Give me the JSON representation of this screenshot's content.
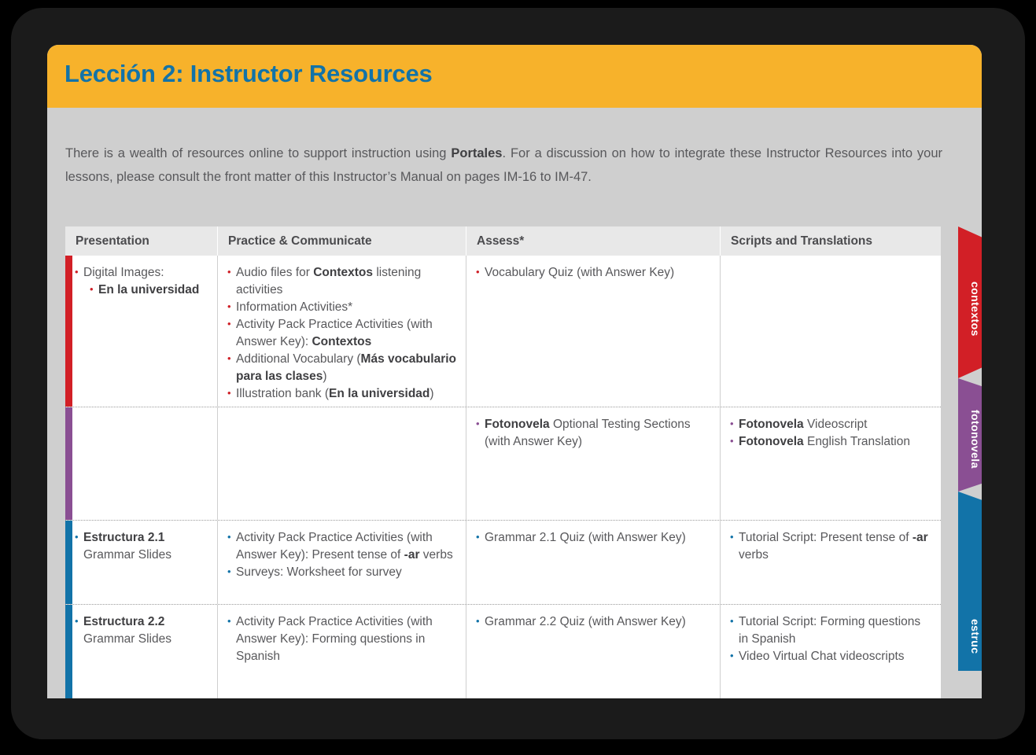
{
  "header": {
    "title": "Lección 2: Instructor Resources",
    "band_color": "#f7b22b",
    "title_color": "#1273a8"
  },
  "intro": {
    "part1": "There is a wealth of resources online to support instruction using ",
    "bold1": "Portales",
    "part2": ". For a discussion on how to integrate these Instructor Resources into your lessons, please consult the front matter of this Instructor’s Manual on pages IM-16 to IM-47."
  },
  "table": {
    "columns": [
      "Presentation",
      "Practice & Communicate",
      "Assess*",
      "Scripts and Translations"
    ],
    "rows": [
      {
        "tab_label": "contextos",
        "color": "#d21f26",
        "presentation": [
          {
            "text": "Digital Images:",
            "sub": false,
            "bold": false
          },
          {
            "text": "En la universidad",
            "sub": true,
            "bold": true
          }
        ],
        "practice": [
          {
            "pre": "Audio files for ",
            "bold": "Contextos",
            "post": " listening activities"
          },
          {
            "pre": "Information Activities*",
            "bold": "",
            "post": ""
          },
          {
            "pre": "Activity Pack Practice Activities (with Answer Key): ",
            "bold": "Contextos",
            "post": ""
          },
          {
            "pre": "Additional Vocabulary (",
            "bold": "Más vocabulario para las clases",
            "post": ")"
          },
          {
            "pre": "Illustration bank (",
            "bold": "En la universidad",
            "post": ")"
          }
        ],
        "assess": [
          {
            "pre": "Vocabulary Quiz (with Answer Key)",
            "bold": "",
            "post": ""
          }
        ],
        "scripts": []
      },
      {
        "tab_label": "fotonovela",
        "color": "#8a4f93",
        "presentation": [],
        "practice": [],
        "assess": [
          {
            "pre": "",
            "bold": "Fotonovela",
            "post": " Optional Testing Sections (with Answer Key)"
          }
        ],
        "scripts": [
          {
            "pre": "",
            "bold": "Fotonovela",
            "post": " Videoscript"
          },
          {
            "pre": "",
            "bold": "Fotonovela",
            "post": " English Translation"
          }
        ]
      },
      {
        "tab_label": "",
        "color": "#1273a8",
        "presentation": [
          {
            "text": "Estructura 2.1",
            "sub": false,
            "bold": true,
            "second": "Grammar Slides"
          }
        ],
        "practice": [
          {
            "pre": "Activity Pack Practice Activities (with Answer Key): Present tense of ",
            "bold": "-ar",
            "post": " verbs"
          },
          {
            "pre": "Surveys: Worksheet for survey",
            "bold": "",
            "post": ""
          }
        ],
        "assess": [
          {
            "pre": "Grammar 2.1 Quiz (with Answer Key)",
            "bold": "",
            "post": ""
          }
        ],
        "scripts": [
          {
            "pre": "Tutorial Script: Present tense of ",
            "bold": "-ar",
            "post": " verbs"
          }
        ]
      },
      {
        "tab_label": "estruc",
        "color": "#1273a8",
        "presentation": [
          {
            "text": "Estructura 2.2",
            "sub": false,
            "bold": true,
            "second": "Grammar Slides"
          }
        ],
        "practice": [
          {
            "pre": "Activity Pack Practice Activities (with Answer Key): Forming questions in Spanish",
            "bold": "",
            "post": ""
          }
        ],
        "assess": [
          {
            "pre": "Grammar 2.2 Quiz (with Answer Key)",
            "bold": "",
            "post": ""
          }
        ],
        "scripts": [
          {
            "pre": "Tutorial Script: Forming questions in Spanish",
            "bold": "",
            "post": ""
          },
          {
            "pre": "Video Virtual Chat videoscripts",
            "bold": "",
            "post": ""
          }
        ]
      }
    ]
  }
}
